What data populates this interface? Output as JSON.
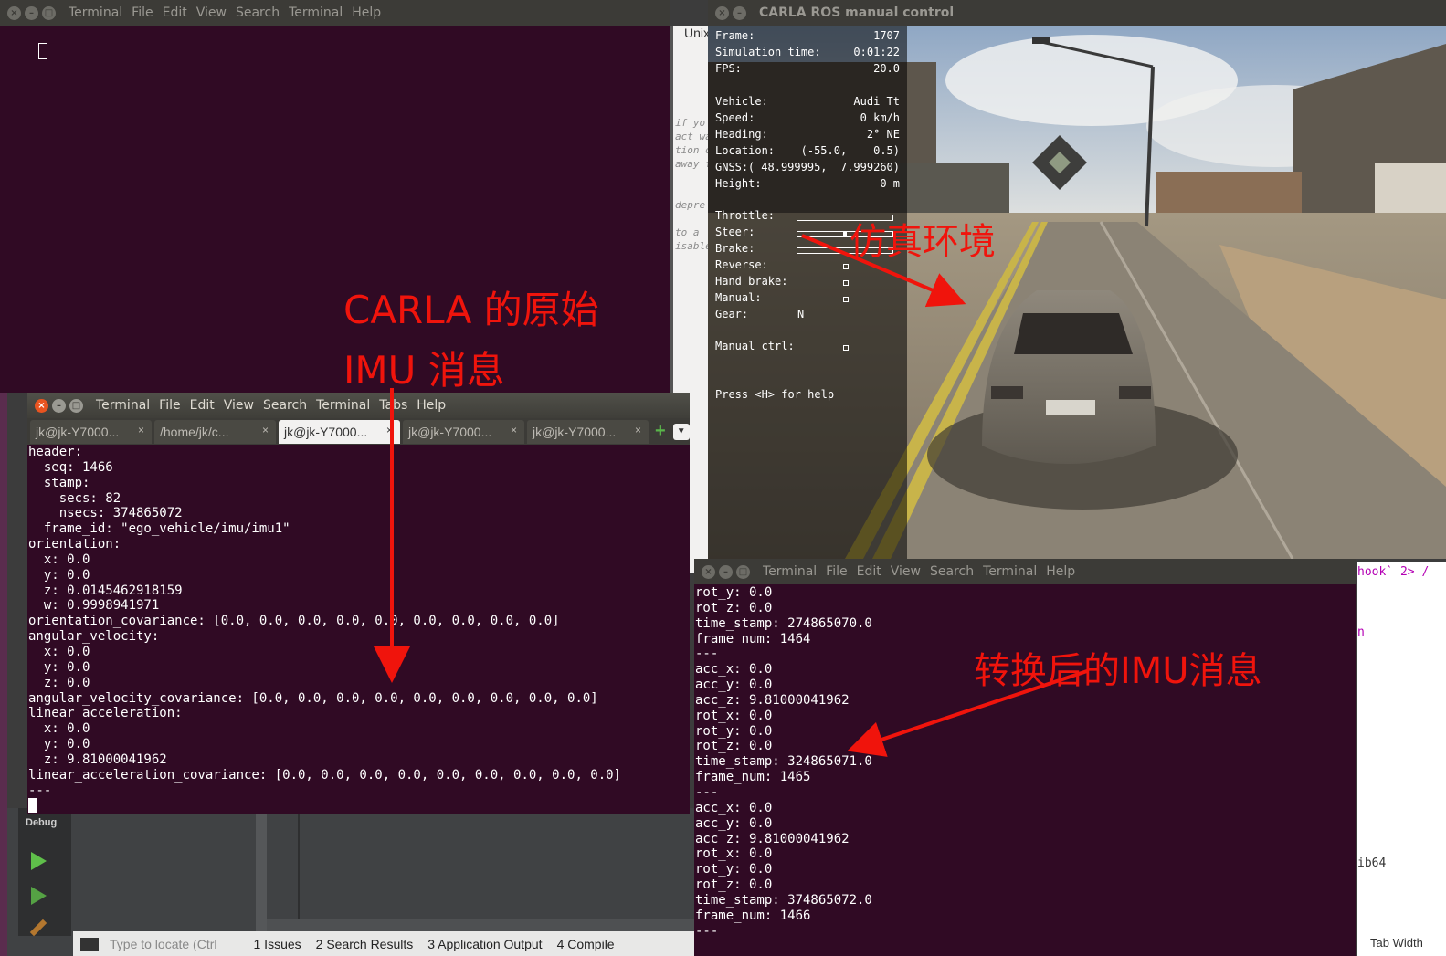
{
  "top_left_terminal": {
    "menu": [
      "Terminal",
      "File",
      "Edit",
      "View",
      "Search",
      "Terminal",
      "Help"
    ]
  },
  "ide_background": {
    "tab_fragment": "Unix",
    "code_fragments": [
      "if yo",
      "act wa",
      "tion o",
      "away f",
      "depre",
      "to a",
      "isable"
    ],
    "sidebar_label": "Debug",
    "status_items": [
      "Type to locate (Ctrl",
      "1 Issues",
      "2 Search Results",
      "3 Application Output",
      "4 Compile"
    ],
    "right_fragments": [
      "hook` 2> /",
      "n",
      "ib64",
      "Tab Width"
    ]
  },
  "carla_window": {
    "title": "CARLA ROS manual control",
    "hud": {
      "frame_label": "Frame:",
      "frame_value": "1707",
      "sim_time_label": "Simulation time:",
      "sim_time_value": "0:01:22",
      "fps_label": "FPS:",
      "fps_value": "20.0",
      "vehicle_label": "Vehicle:",
      "vehicle_value": "Audi Tt",
      "speed_label": "Speed:",
      "speed_value": "0 km/h",
      "heading_label": "Heading:",
      "heading_value": "2° NE",
      "location_label": "Location:",
      "location_value": "(-55.0,    0.5)",
      "gnss_label": "GNSS:",
      "gnss_value": "( 48.999995,  7.999260)",
      "height_label": "Height:",
      "height_value": "-0 m",
      "throttle_label": "Throttle:",
      "steer_label": "Steer:",
      "brake_label": "Brake:",
      "reverse_label": "Reverse:",
      "hand_brake_label": "Hand brake:",
      "manual_label": "Manual:",
      "gear_label": "Gear:",
      "gear_value": "N",
      "manual_ctrl_label": "Manual ctrl:",
      "help_text": "Press <H> for help"
    }
  },
  "raw_imu_terminal": {
    "menu": [
      "Terminal",
      "File",
      "Edit",
      "View",
      "Search",
      "Terminal",
      "Tabs",
      "Help"
    ],
    "tabs": [
      "jk@jk-Y7000...",
      "/home/jk/c...",
      "jk@jk-Y7000...",
      "jk@jk-Y7000...",
      "jk@jk-Y7000..."
    ],
    "selected_tab": 2,
    "lines": [
      "header:",
      "  seq: 1466",
      "  stamp:",
      "    secs: 82",
      "    nsecs: 374865072",
      "  frame_id: \"ego_vehicle/imu/imu1\"",
      "orientation:",
      "  x: 0.0",
      "  y: 0.0",
      "  z: 0.0145462918159",
      "  w: 0.9998941971",
      "orientation_covariance: [0.0, 0.0, 0.0, 0.0, 0.0, 0.0, 0.0, 0.0, 0.0]",
      "angular_velocity:",
      "  x: 0.0",
      "  y: 0.0",
      "  z: 0.0",
      "angular_velocity_covariance: [0.0, 0.0, 0.0, 0.0, 0.0, 0.0, 0.0, 0.0, 0.0]",
      "linear_acceleration:",
      "  x: 0.0",
      "  y: 0.0",
      "  z: 9.81000041962",
      "linear_acceleration_covariance: [0.0, 0.0, 0.0, 0.0, 0.0, 0.0, 0.0, 0.0, 0.0]",
      "---"
    ]
  },
  "converted_imu_terminal": {
    "menu": [
      "Terminal",
      "File",
      "Edit",
      "View",
      "Search",
      "Terminal",
      "Help"
    ],
    "lines": [
      "rot_y: 0.0",
      "rot_z: 0.0",
      "time_stamp: 274865070.0",
      "frame_num: 1464",
      "---",
      "acc_x: 0.0",
      "acc_y: 0.0",
      "acc_z: 9.81000041962",
      "rot_x: 0.0",
      "rot_y: 0.0",
      "rot_z: 0.0",
      "time_stamp: 324865071.0",
      "frame_num: 1465",
      "---",
      "acc_x: 0.0",
      "acc_y: 0.0",
      "acc_z: 9.81000041962",
      "rot_x: 0.0",
      "rot_y: 0.0",
      "rot_z: 0.0",
      "time_stamp: 374865072.0",
      "frame_num: 1466",
      "---"
    ]
  },
  "annotations": {
    "sim_env": "仿真环境",
    "carla_raw_line1": "CARLA 的原始",
    "carla_raw_line2": "IMU 消息",
    "converted": "转换后的IMU消息"
  },
  "colors": {
    "terminal_bg": "#300a24",
    "annotation_red": "#f0140c",
    "ubuntu_orange": "#e95420"
  }
}
